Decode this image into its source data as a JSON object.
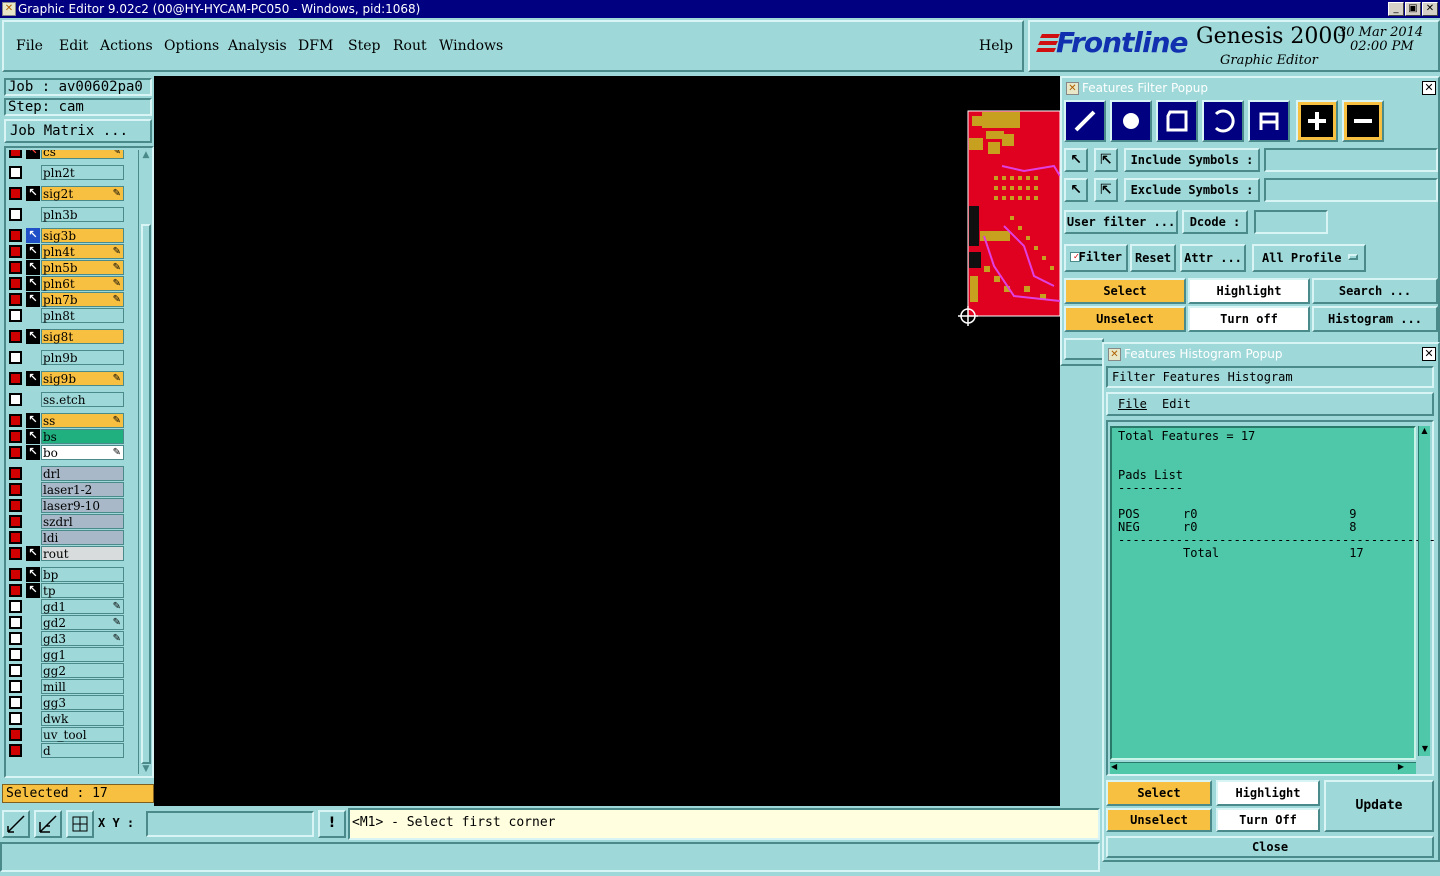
{
  "window": {
    "title": "Graphic Editor 9.02c2 (00@HY-HYCAM-PC050 - Windows, pid:1068)"
  },
  "menubar": {
    "items": [
      {
        "label": "File"
      },
      {
        "label": "Edit"
      },
      {
        "label": "Actions"
      },
      {
        "label": "Options"
      },
      {
        "label": "Analysis"
      },
      {
        "label": "DFM"
      },
      {
        "label": "Step"
      },
      {
        "label": "Rout"
      },
      {
        "label": "Windows"
      }
    ],
    "help": "Help"
  },
  "brand": {
    "logo": "Frontline",
    "product": "Genesis 2000",
    "subtitle": "Graphic Editor",
    "date": "30 Mar 2014",
    "time": "02:00 PM"
  },
  "left": {
    "job": "Job : av00602pa0",
    "step": "Step: cam",
    "job_matrix": "Job Matrix ...",
    "selected": "Selected : 17"
  },
  "layers": [
    {
      "name": "cs",
      "checked": true,
      "arrow": "red",
      "color": "orange",
      "pen": true
    },
    {
      "name": "pln2t",
      "checked": false,
      "arrow": "none",
      "color": "cyan",
      "pen": false
    },
    {
      "name": "sig2t",
      "checked": true,
      "arrow": "black",
      "color": "orange",
      "pen": true
    },
    {
      "name": "pln3b",
      "checked": false,
      "arrow": "none",
      "color": "cyan",
      "pen": false
    },
    {
      "name": "sig3b",
      "checked": true,
      "arrow": "blue",
      "color": "orange",
      "pen": false
    },
    {
      "name": "pln4t",
      "checked": true,
      "arrow": "black",
      "color": "orange",
      "pen": true
    },
    {
      "name": "pln5b",
      "checked": true,
      "arrow": "black",
      "color": "orange",
      "pen": true
    },
    {
      "name": "pln6t",
      "checked": true,
      "arrow": "black",
      "color": "orange",
      "pen": true
    },
    {
      "name": "pln7b",
      "checked": true,
      "arrow": "black",
      "color": "orange",
      "pen": true
    },
    {
      "name": "pln8t",
      "checked": false,
      "arrow": "none",
      "color": "cyan",
      "pen": false
    },
    {
      "name": "sig8t",
      "checked": true,
      "arrow": "black",
      "color": "orange",
      "pen": false
    },
    {
      "name": "pln9b",
      "checked": false,
      "arrow": "none",
      "color": "cyan",
      "pen": false
    },
    {
      "name": "sig9b",
      "checked": true,
      "arrow": "black",
      "color": "orange",
      "pen": true
    },
    {
      "name": "ss.etch",
      "checked": false,
      "arrow": "none",
      "color": "cyan",
      "pen": false
    },
    {
      "name": "ss",
      "checked": true,
      "arrow": "black",
      "color": "orange",
      "pen": true
    },
    {
      "name": "bs",
      "checked": true,
      "arrow": "black",
      "color": "green",
      "pen": false
    },
    {
      "name": "bo",
      "checked": true,
      "arrow": "black",
      "color": "white",
      "pen": true
    },
    {
      "name": "drl",
      "checked": true,
      "arrow": "none",
      "color": "gray",
      "pen": false
    },
    {
      "name": "laser1-2",
      "checked": true,
      "arrow": "none",
      "color": "gray",
      "pen": false
    },
    {
      "name": "laser9-10",
      "checked": true,
      "arrow": "none",
      "color": "gray",
      "pen": false
    },
    {
      "name": "szdrl",
      "checked": true,
      "arrow": "none",
      "color": "gray",
      "pen": false
    },
    {
      "name": "ldi",
      "checked": true,
      "arrow": "none",
      "color": "gray",
      "pen": false
    },
    {
      "name": "rout",
      "checked": true,
      "arrow": "black",
      "color": "lgray",
      "pen": false
    },
    {
      "name": "bp",
      "checked": true,
      "arrow": "black",
      "color": "cyan",
      "pen": false
    },
    {
      "name": "tp",
      "checked": true,
      "arrow": "black",
      "color": "cyan",
      "pen": false
    },
    {
      "name": "gd1",
      "checked": false,
      "arrow": "none",
      "color": "cyan",
      "pen": true
    },
    {
      "name": "gd2",
      "checked": false,
      "arrow": "none",
      "color": "cyan",
      "pen": true
    },
    {
      "name": "gd3",
      "checked": false,
      "arrow": "none",
      "color": "cyan",
      "pen": true
    },
    {
      "name": "gg1",
      "checked": false,
      "arrow": "none",
      "color": "cyan",
      "pen": false
    },
    {
      "name": "gg2",
      "checked": false,
      "arrow": "none",
      "color": "cyan",
      "pen": false
    },
    {
      "name": "mill",
      "checked": false,
      "arrow": "none",
      "color": "cyan",
      "pen": false
    },
    {
      "name": "gg3",
      "checked": false,
      "arrow": "none",
      "color": "cyan",
      "pen": false
    },
    {
      "name": "dwk",
      "checked": false,
      "arrow": "none",
      "color": "cyan",
      "pen": false
    },
    {
      "name": "uv_tool",
      "checked": true,
      "arrow": "none",
      "color": "cyan",
      "pen": false
    },
    {
      "name": "d",
      "checked": true,
      "arrow": "none",
      "color": "cyan",
      "pen": false
    }
  ],
  "bottombar": {
    "xy_label": "X Y :",
    "xy_value": "",
    "prompt": "<M1> - Select first corner"
  },
  "filter_popup": {
    "title": "Features Filter Popup",
    "include_symbols": "Include Symbols :",
    "exclude_symbols": "Exclude Symbols :",
    "user_filter": "User filter ...",
    "dcode": "Dcode :",
    "filter": "Filter",
    "reset": "Reset",
    "attr": "Attr ...",
    "profile": "All Profile",
    "select": "Select",
    "highlight": "Highlight",
    "search": "Search ...",
    "unselect": "Unselect",
    "turn_off": "Turn off",
    "histogram": "Histogram ..."
  },
  "histogram_popup": {
    "title": "Features Histogram Popup",
    "heading": "Filter Features Histogram",
    "menu_file": "File",
    "menu_edit": "Edit",
    "text": "Total Features = 17\n\n\nPads List\n---------\n\nPOS      r0                     9\nNEG      r0                     8\n--------------------------------------------\n         Total                  17",
    "select": "Select",
    "highlight": "Highlight",
    "update": "Update",
    "unselect": "Unselect",
    "turn_off": "Turn Off",
    "close": "Close"
  },
  "colors": {
    "panel": "#9ed8d8",
    "orange": "#f8c040",
    "board_red": "#e00020",
    "title_bar": "#000080"
  }
}
